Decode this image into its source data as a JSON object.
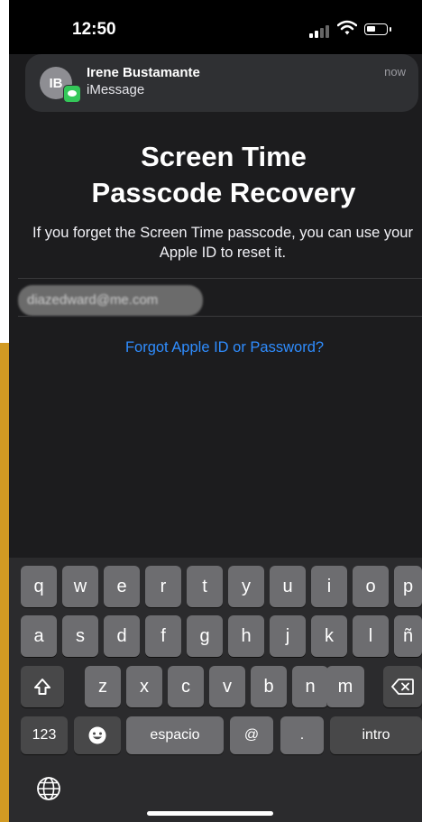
{
  "status": {
    "time": "12:50"
  },
  "notification": {
    "initials": "IB",
    "sender": "Irene Bustamante",
    "app": "iMessage",
    "time": "now"
  },
  "title_line1": "Screen Time",
  "title_line2": "Passcode Recovery",
  "subtitle": "If you forget the Screen Time passcode, you can use your Apple ID to reset it.",
  "apple_id_value": "diazedward@me.com",
  "forgot_link": "Forgot Apple ID or Password?",
  "keyboard": {
    "row1": [
      "q",
      "w",
      "e",
      "r",
      "t",
      "y",
      "u",
      "i",
      "o",
      "p"
    ],
    "row2": [
      "a",
      "s",
      "d",
      "f",
      "g",
      "h",
      "j",
      "k",
      "l",
      "ñ"
    ],
    "row3": [
      "z",
      "x",
      "c",
      "v",
      "b",
      "n",
      "m"
    ],
    "numbers_label": "123",
    "space_label": "espacio",
    "at_label": "@",
    "dot_label": ".",
    "return_label": "intro",
    "shift_icon": "shift-icon",
    "delete_icon": "delete-icon",
    "emoji_icon": "emoji-icon",
    "globe_icon": "globe-icon"
  },
  "colors": {
    "link": "#2f8dff",
    "background": "#1c1c1e",
    "imessage_badge": "#34c759"
  }
}
